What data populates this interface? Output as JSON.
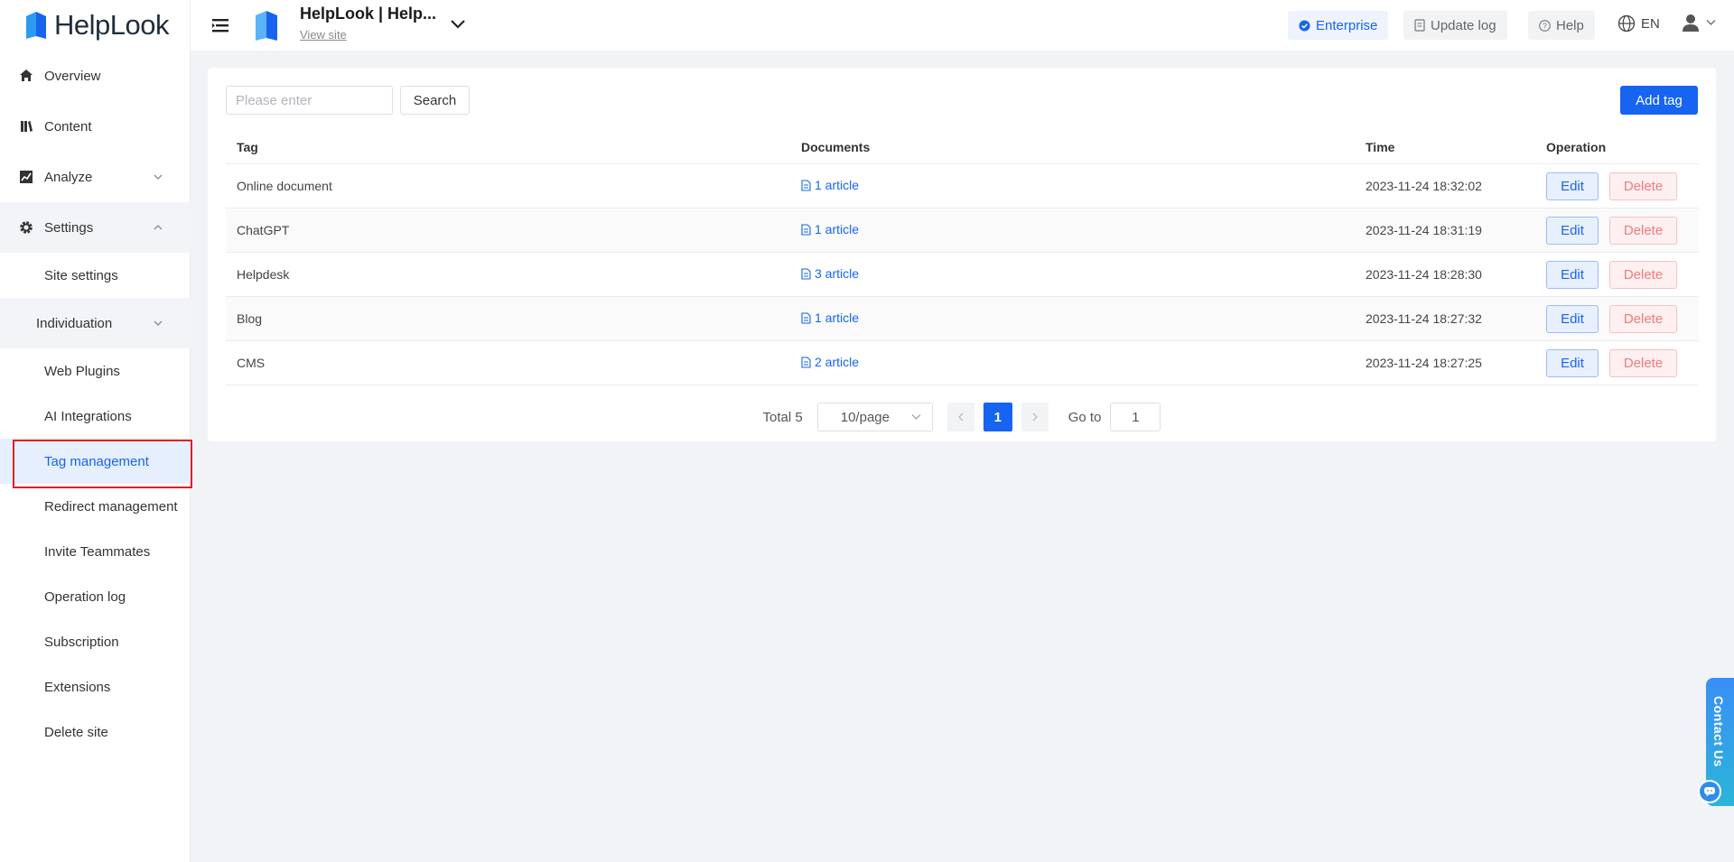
{
  "app": {
    "brand": "HelpLook"
  },
  "topbar": {
    "site_title": "HelpLook | Help...",
    "view_site": "View site",
    "enterprise": "Enterprise",
    "update_log": "Update log",
    "help": "Help",
    "lang": "EN"
  },
  "sidebar": {
    "items": [
      {
        "label": "Overview"
      },
      {
        "label": "Content"
      },
      {
        "label": "Analyze"
      },
      {
        "label": "Settings"
      }
    ],
    "site_settings": "Site settings",
    "individuation": "Individuation",
    "sub_items": [
      {
        "label": "Web Plugins"
      },
      {
        "label": "AI Integrations"
      },
      {
        "label": "Tag management"
      },
      {
        "label": "Redirect management"
      },
      {
        "label": "Invite Teammates"
      },
      {
        "label": "Operation log"
      },
      {
        "label": "Subscription"
      },
      {
        "label": "Extensions"
      },
      {
        "label": "Delete site"
      }
    ]
  },
  "main": {
    "search_placeholder": "Please enter",
    "search_label": "Search",
    "add_tag_label": "Add tag",
    "columns": [
      "Tag",
      "Documents",
      "Time",
      "Operation"
    ],
    "rows": [
      {
        "tag": "Online document",
        "documents": "1 article",
        "time": "2023-11-24 18:32:02"
      },
      {
        "tag": "ChatGPT",
        "documents": "1 article",
        "time": "2023-11-24 18:31:19"
      },
      {
        "tag": "Helpdesk",
        "documents": "3 article",
        "time": "2023-11-24 18:28:30"
      },
      {
        "tag": "Blog",
        "documents": "1 article",
        "time": "2023-11-24 18:27:32"
      },
      {
        "tag": "CMS",
        "documents": "2 article",
        "time": "2023-11-24 18:27:25"
      }
    ],
    "edit_label": "Edit",
    "delete_label": "Delete",
    "pagination": {
      "total": "Total 5",
      "page_size": "10/page",
      "current_page": "1",
      "goto_label": "Go to",
      "goto_value": "1"
    }
  },
  "contact": {
    "label": "Contact Us"
  },
  "colors": {
    "accent": "#1664f0",
    "danger": "#ef7b7b",
    "highlight": "#e02020"
  }
}
